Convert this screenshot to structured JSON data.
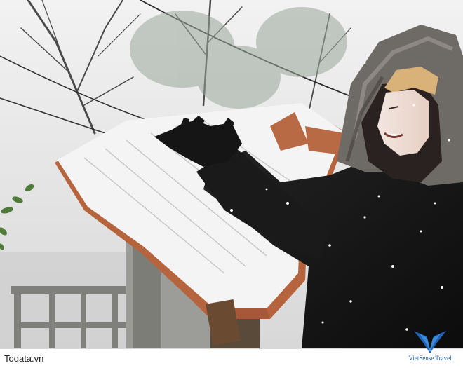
{
  "photo": {
    "subject": "Person in a dark winter coat with a fur-trimmed hood catching falling snow on a snow-covered tiled roof",
    "colors": {
      "sky": "#e9e9e9",
      "fog": "#d9d9d9",
      "coat": "#151515",
      "hood_fur": "#6e6a66",
      "roof_tile": "#b5643e",
      "snow": "#f4f4f4",
      "railing": "#7f807c"
    }
  },
  "footer": {
    "site_label": "Todata.vn",
    "brand_text": "VietSense Travel",
    "brand_color": "#1f63b8"
  }
}
